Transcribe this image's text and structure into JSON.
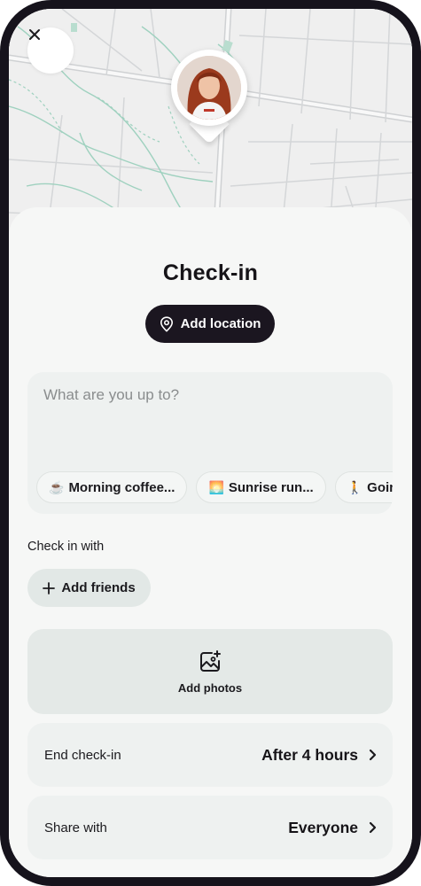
{
  "header": {
    "title": "Check-in"
  },
  "location_button": {
    "label": "Add location"
  },
  "composer": {
    "placeholder": "What are you up to?",
    "suggestions": [
      {
        "emoji": "☕",
        "label": "Morning coffee..."
      },
      {
        "emoji": "🌅",
        "label": "Sunrise run..."
      },
      {
        "emoji": "🚶",
        "label": "Goin"
      }
    ]
  },
  "check_in_with": {
    "label": "Check in with",
    "button_label": "Add friends"
  },
  "photos": {
    "label": "Add photos"
  },
  "settings": [
    {
      "label": "End check-in",
      "value": "After 4 hours"
    },
    {
      "label": "Share with",
      "value": "Everyone"
    }
  ],
  "icons": {
    "close": "close-icon",
    "location": "location-pin-icon",
    "add": "plus-icon",
    "photo": "add-photo-icon",
    "chevron": "chevron-right-icon"
  },
  "colors": {
    "dark": "#1b1620",
    "sheet": "#f6f7f6",
    "surface": "#eef1f0",
    "map_road": "#bfc2c4",
    "map_path": "#9fd1bf"
  }
}
